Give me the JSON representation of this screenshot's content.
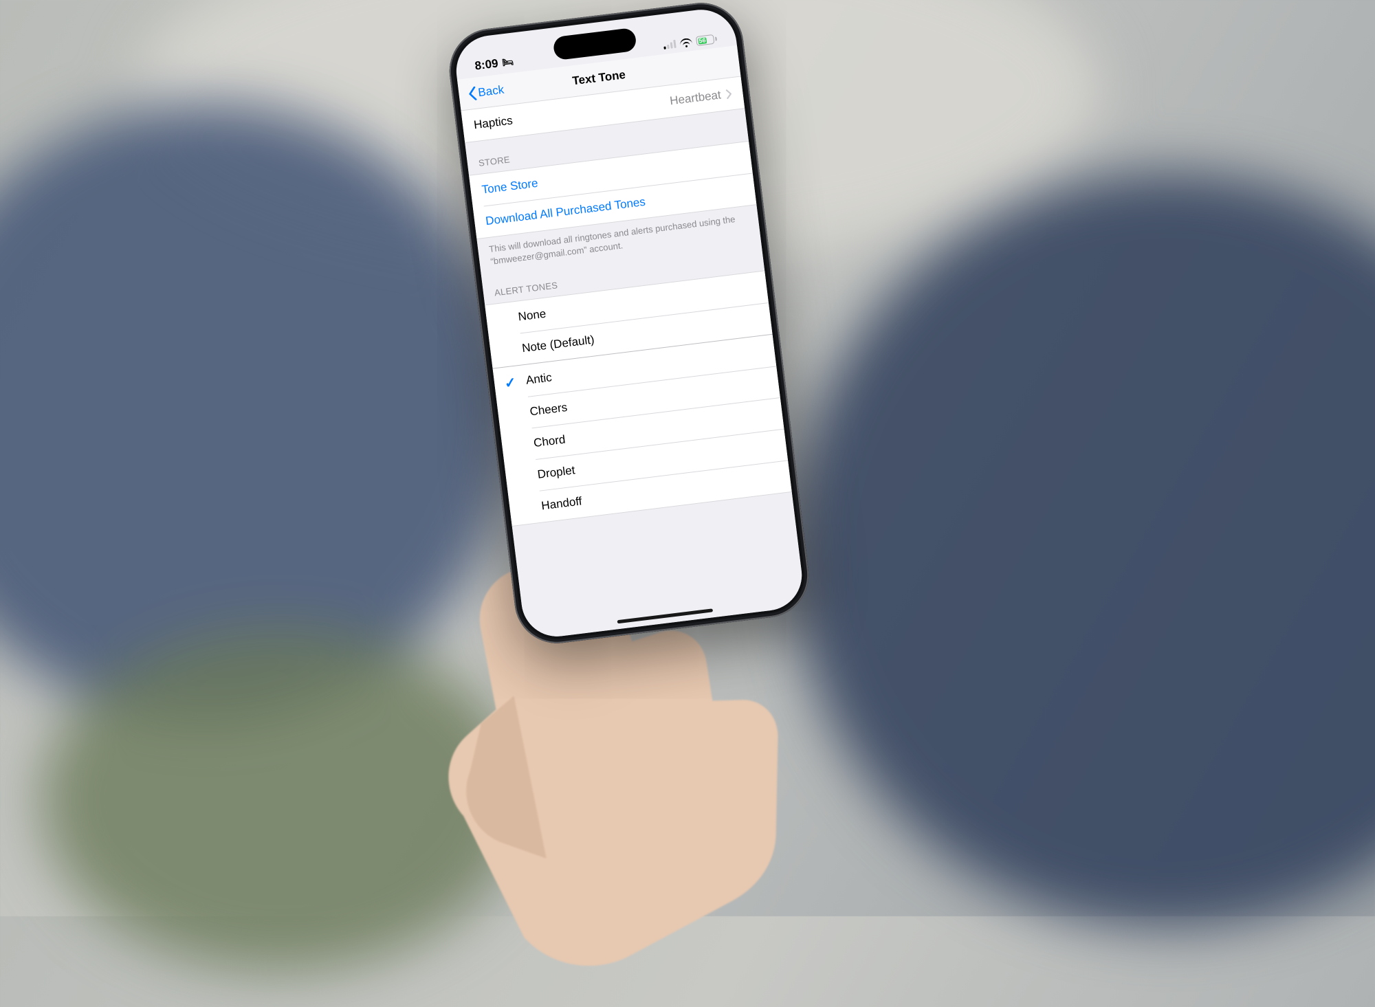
{
  "status": {
    "time": "8:09",
    "battery_pct": "56"
  },
  "nav": {
    "back_label": "Back",
    "title": "Text Tone"
  },
  "haptics": {
    "label": "Haptics",
    "value": "Heartbeat"
  },
  "store": {
    "header": "STORE",
    "tone_store": "Tone Store",
    "download_all": "Download All Purchased Tones",
    "footer": "This will download all ringtones and alerts purchased using the “bmweezer@gmail.com” account."
  },
  "alert_tones": {
    "header": "ALERT TONES",
    "items": [
      {
        "label": "None",
        "selected": false
      },
      {
        "label": "Note (Default)",
        "selected": false
      },
      {
        "label": "Antic",
        "selected": true
      },
      {
        "label": "Cheers",
        "selected": false
      },
      {
        "label": "Chord",
        "selected": false
      },
      {
        "label": "Droplet",
        "selected": false
      },
      {
        "label": "Handoff",
        "selected": false
      }
    ]
  }
}
